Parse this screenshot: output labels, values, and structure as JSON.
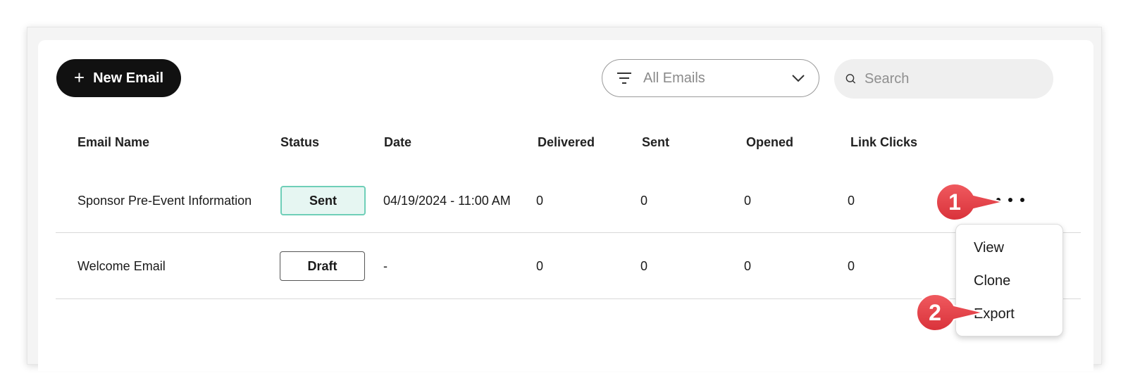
{
  "toolbar": {
    "new_email_label": "New Email",
    "filter_value": "All Emails",
    "search_placeholder": "Search"
  },
  "table": {
    "columns": [
      "Email Name",
      "Status",
      "Date",
      "Delivered",
      "Sent",
      "Opened",
      "Link Clicks"
    ],
    "rows": [
      {
        "name": "Sponsor Pre-Event Information",
        "status": "Sent",
        "date": "04/19/2024 - 11:00 AM",
        "delivered": "0",
        "sent": "0",
        "opened": "0",
        "link_clicks": "0"
      },
      {
        "name": "Welcome Email",
        "status": "Draft",
        "date": "-",
        "delivered": "0",
        "sent": "0",
        "opened": "0",
        "link_clicks": "0"
      }
    ]
  },
  "menu": {
    "items": [
      "View",
      "Clone",
      "Export"
    ]
  },
  "callouts": [
    "1",
    "2"
  ],
  "colors": {
    "callout_red": "#e8424a",
    "sent_badge_bg": "#e6f6f2",
    "sent_badge_border": "#6fcfb8",
    "primary_button": "#111111"
  }
}
